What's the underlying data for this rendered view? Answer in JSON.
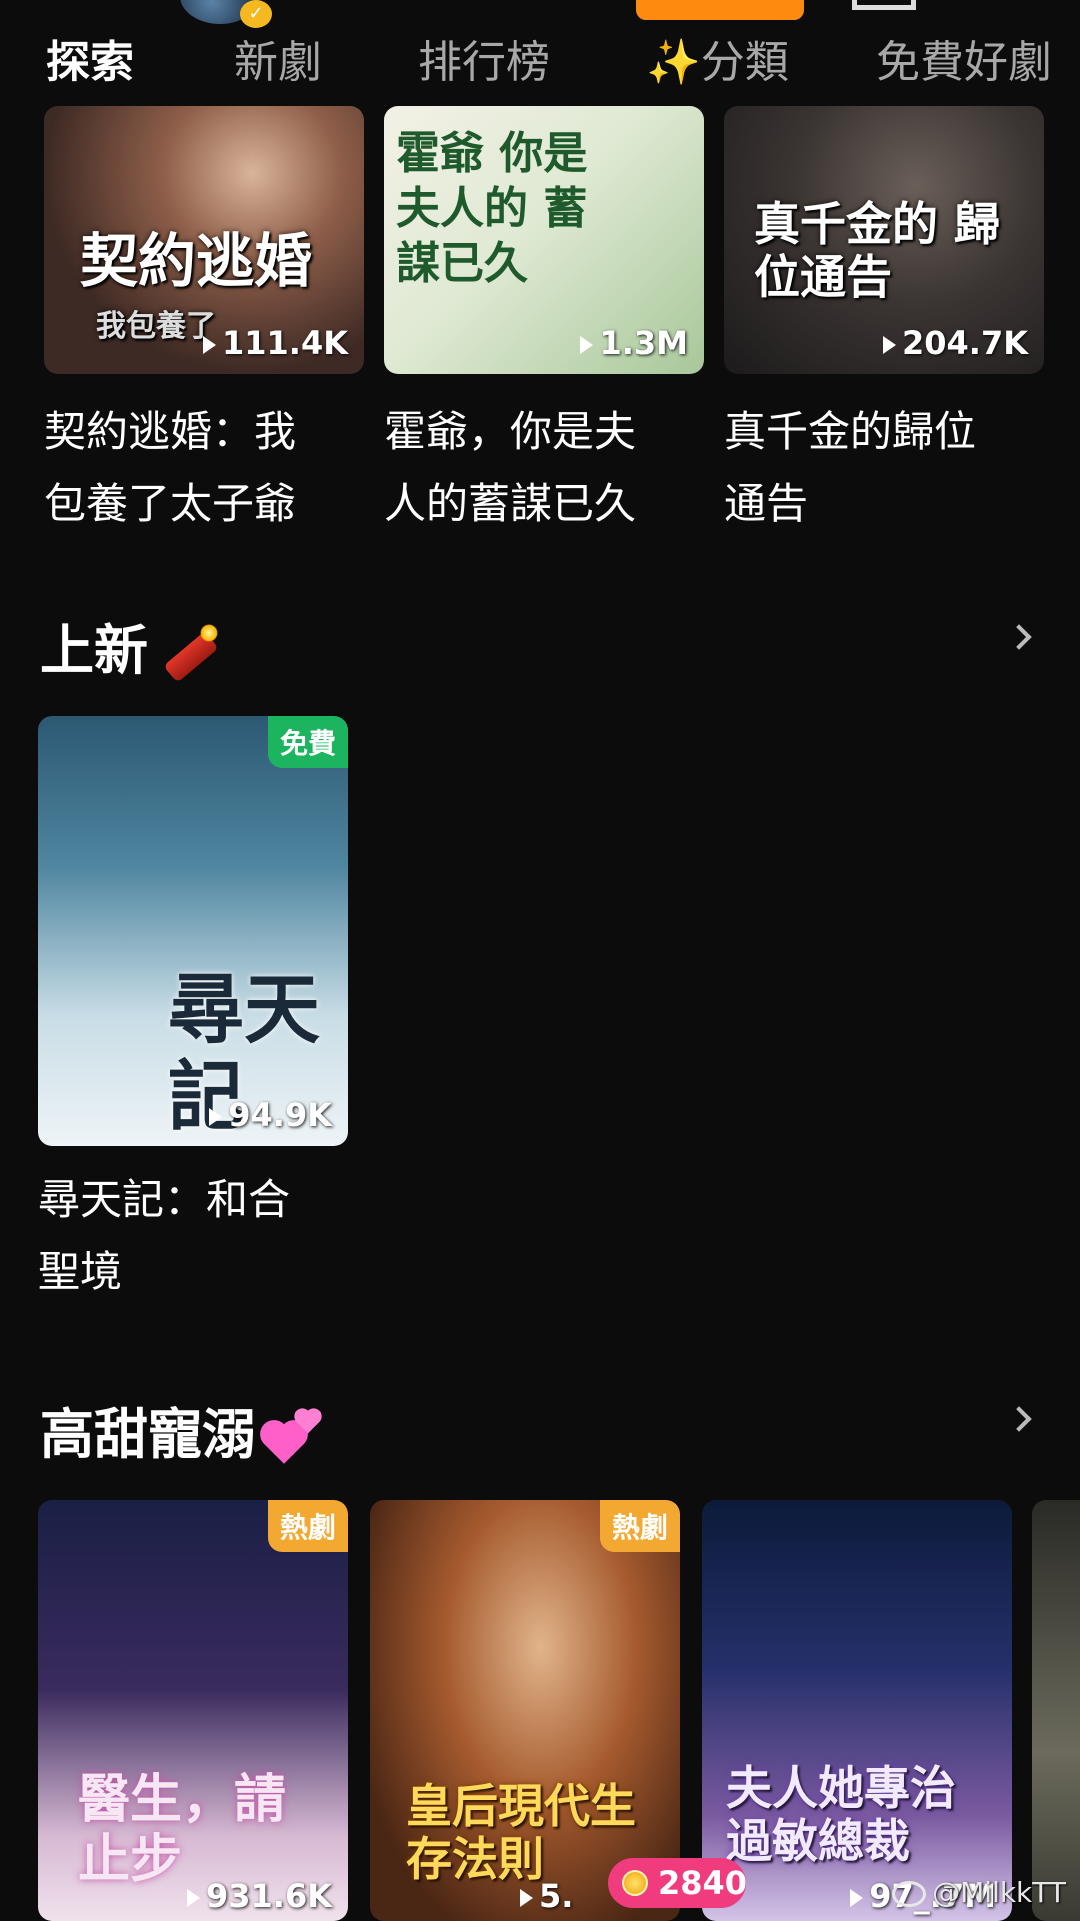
{
  "tabs": [
    "探索",
    "新劇",
    "排行榜",
    "✨分類",
    "免費好劇"
  ],
  "top_row": [
    {
      "poster_title": "契約逃婚",
      "poster_subtitle": "我包養了",
      "views": "111.4K",
      "title": "契約逃婚：我包養了太子爺",
      "title_lines": [
        "契約逃婚：我",
        "包養了太子爺"
      ]
    },
    {
      "poster_title": "霍爺 你是夫人的 蓄謀已久",
      "views": "1.3M",
      "title": "霍爺，你是夫人的蓄謀已久",
      "title_lines": [
        "霍爺，你是夫",
        "人的蓄謀已久"
      ]
    },
    {
      "poster_title": "真千金的 歸位通告",
      "views": "204.7K",
      "title": "真千金的歸位通告",
      "title_lines": [
        "真千金的歸位",
        "通告"
      ]
    }
  ],
  "section_new": {
    "header": "上新",
    "card": {
      "badge": "免費",
      "poster_title": "尋天記",
      "views": "94.9K",
      "title_lines": [
        "尋天記：和合",
        "聖境"
      ]
    }
  },
  "section_sweet": {
    "header": "高甜寵溺",
    "cards": [
      {
        "badge": "熱劇",
        "poster_title": "醫生，請止步",
        "views": "931.6K"
      },
      {
        "badge": "熱劇",
        "poster_title": "皇后現代生存法則",
        "views": "5."
      },
      {
        "poster_title": "夫人她專治過敏總裁",
        "views": "97_.7M"
      }
    ]
  },
  "coin_count": "2840",
  "watermark": "@MilkkTT",
  "colors": {
    "background": "#0c0c0d",
    "badge_free": "#1db45f",
    "badge_hot": "#f3a832",
    "coin_pill": "#f03b7f",
    "accent_orange": "#ff8a10"
  }
}
